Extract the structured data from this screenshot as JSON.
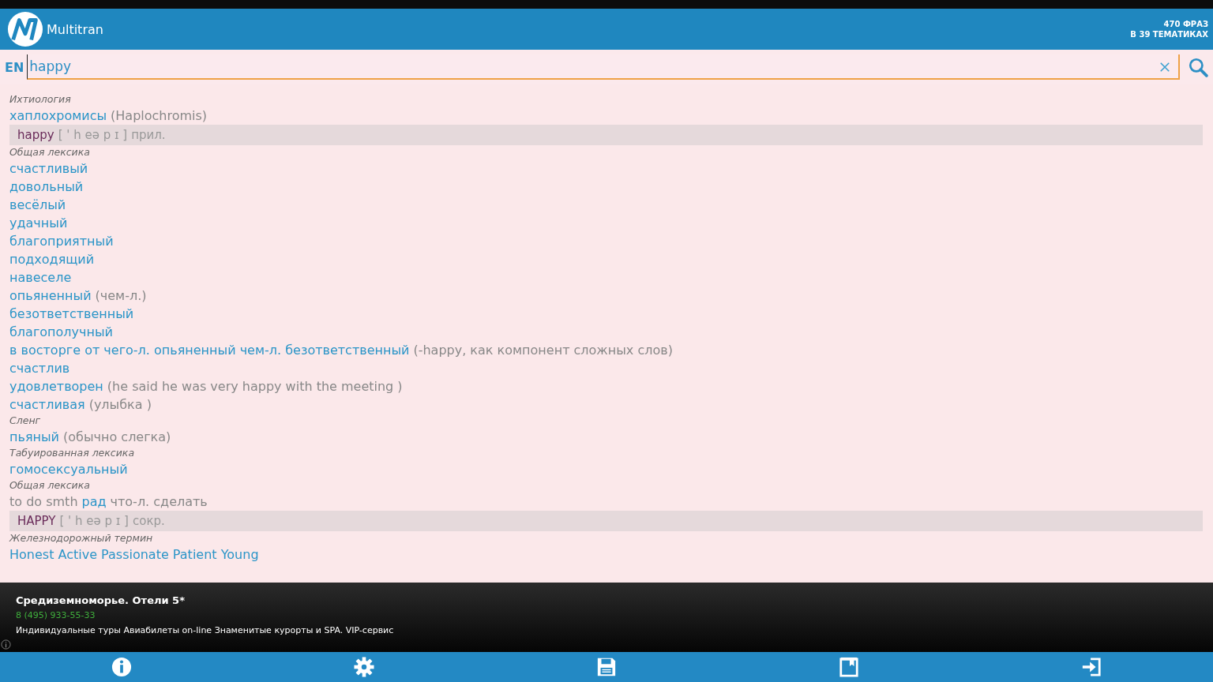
{
  "app_bar": {
    "title": "Multitran",
    "stats": [
      "470 ФРАЗ",
      "В 39 ТЕМАТИКАХ"
    ]
  },
  "search": {
    "language": "EN",
    "value": "happy"
  },
  "results": [
    {
      "kind": "topic",
      "text": "Ихтиология"
    },
    {
      "kind": "translation",
      "text": "хаплохромисы",
      "note": "(Haplochromis)"
    },
    {
      "kind": "headword",
      "word": "happy",
      "transcription": "[ ' h eə p ɪ ]",
      "pos": "прил."
    },
    {
      "kind": "topic",
      "text": "Общая лексика"
    },
    {
      "kind": "translation",
      "text": "счастливый"
    },
    {
      "kind": "translation",
      "text": "довольный"
    },
    {
      "kind": "translation",
      "text": "весёлый"
    },
    {
      "kind": "translation",
      "text": "удачный"
    },
    {
      "kind": "translation",
      "text": "благоприятный"
    },
    {
      "kind": "translation",
      "text": "подходящий"
    },
    {
      "kind": "translation",
      "text": "навеселе"
    },
    {
      "kind": "translation",
      "text": "опьяненный",
      "note": "(чем-л.)"
    },
    {
      "kind": "translation",
      "text": "безответственный"
    },
    {
      "kind": "translation",
      "text": "благополучный"
    },
    {
      "kind": "translation",
      "text": "в восторге от чего-л. опьяненный чем-л. безответственный",
      "note": "(-happy, как компонент сложных слов)"
    },
    {
      "kind": "translation",
      "text": "счастлив"
    },
    {
      "kind": "translation",
      "text": "удовлетворен",
      "note": "(he said he was very happy with the meeting )"
    },
    {
      "kind": "translation",
      "text": "счастливая",
      "note": "(улыбка )"
    },
    {
      "kind": "topic",
      "text": "Сленг"
    },
    {
      "kind": "translation",
      "text": "пьяный",
      "note": "(обычно слегка)"
    },
    {
      "kind": "topic",
      "text": "Табуированная лексика"
    },
    {
      "kind": "translation",
      "text": "гомосексуальный"
    },
    {
      "kind": "topic",
      "text": "Общая лексика"
    },
    {
      "kind": "phrase",
      "before": "to do smth",
      "link": "рад",
      "after": "что-л. сделать"
    },
    {
      "kind": "headword",
      "word": "HAPPY",
      "transcription": "[ ' h eə p ɪ ]",
      "pos": "сокр."
    },
    {
      "kind": "topic",
      "text": "Железнодорожный термин"
    },
    {
      "kind": "translation",
      "text": "Honest Active Passionate Patient Young"
    }
  ],
  "ad": {
    "title": "Средиземноморье. Отели 5*",
    "phone": "8 (495) 933-55-33",
    "description": "Индивидуальные туры Авиабилеты on-line Знаменитые курорты и SPA. VIP-сервис"
  },
  "toolbar": [
    {
      "kind": "info"
    },
    {
      "kind": "settings"
    },
    {
      "kind": "save"
    },
    {
      "kind": "bookmarks"
    },
    {
      "kind": "exit"
    }
  ]
}
